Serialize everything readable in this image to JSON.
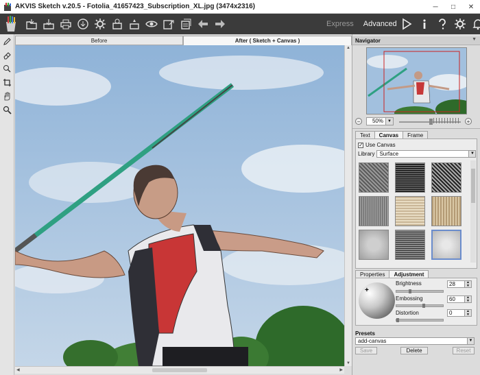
{
  "window": {
    "title": "AKVIS Sketch v.20.5 - Fotolia_41657423_Subscription_XL.jpg (3474x2316)",
    "minimize": "─",
    "maximize": "□",
    "close": "✕"
  },
  "toolbar": {
    "left_icons": [
      "open-icon",
      "save-icon",
      "print-icon",
      "share-icon",
      "settings-gear-icon",
      "batch-icon",
      "preset-icon",
      "eye-icon",
      "export-icon",
      "layers-icon",
      "back-arrow-icon",
      "forward-arrow-icon"
    ],
    "mode_express": "Express",
    "mode_advanced": "Advanced",
    "right_icons": [
      "run-icon",
      "info-icon",
      "help-icon",
      "preferences-icon",
      "bell-icon"
    ]
  },
  "view_tabs": {
    "before": "Before",
    "after": "After ( Sketch + Canvas )"
  },
  "navigator": {
    "title": "Navigator",
    "zoom": "50%",
    "zoom_out": "−",
    "zoom_in": "+"
  },
  "section_tabs": {
    "text": "Text",
    "canvas": "Canvas",
    "frame": "Frame"
  },
  "canvas_tab": {
    "use_canvas_label": "Use Canvas",
    "use_canvas_checked": "✓",
    "library_label": "Library",
    "library_value": "Surface"
  },
  "sub_tabs": {
    "properties": "Properties",
    "adjustment": "Adjustment"
  },
  "adjustment": {
    "brightness_label": "Brightness",
    "brightness_value": "28",
    "brightness_level": 0.28,
    "embossing_label": "Embossing",
    "embossing_value": "60",
    "embossing_level": 0.6,
    "distortion_label": "Distortion",
    "distortion_value": "0",
    "distortion_level": 0.0,
    "sphere_marker": "+"
  },
  "presets": {
    "title": "Presets",
    "value": "add-canvas",
    "save": "Save",
    "delete": "Delete",
    "reset": "Reset"
  },
  "left_tools": [
    "pencil-icon",
    "eraser-icon",
    "history-brush-icon",
    "crop-icon",
    "hand-icon",
    "zoom-icon"
  ]
}
